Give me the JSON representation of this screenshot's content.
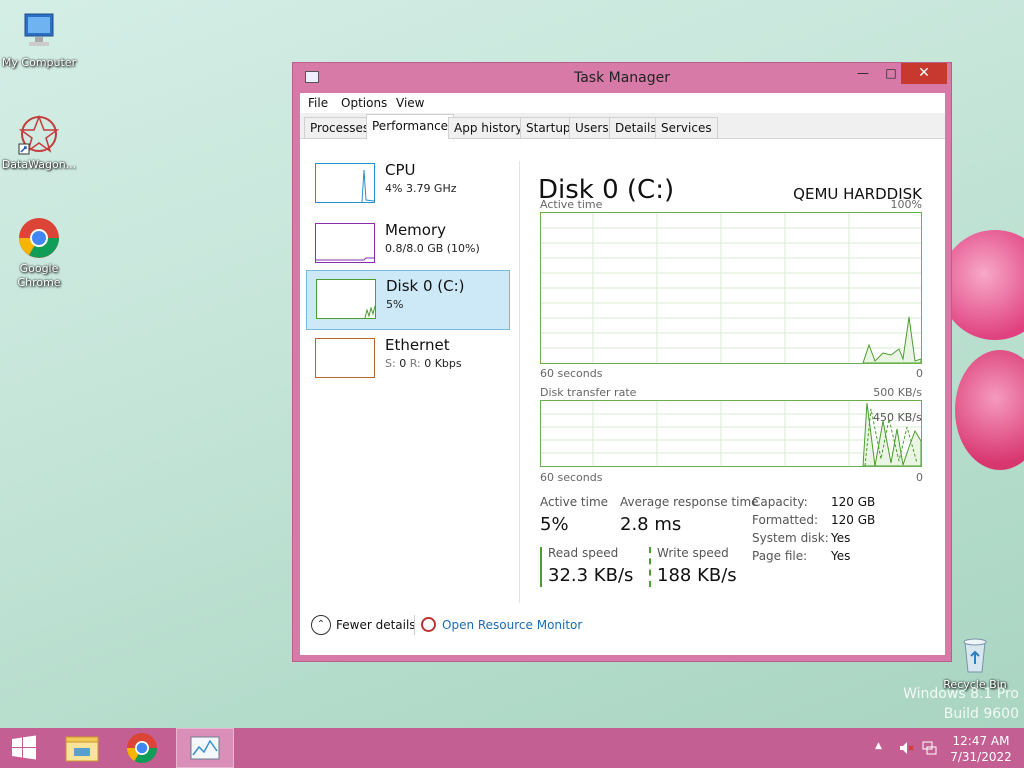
{
  "desktop": {
    "icons": [
      {
        "label": "My Computer"
      },
      {
        "label": "DataWagon..."
      },
      {
        "label": "Google Chrome"
      },
      {
        "label": "Recycle Bin"
      }
    ],
    "watermark": {
      "line1": "Windows 8.1 Pro",
      "line2": "Build 9600"
    }
  },
  "window": {
    "title": "Task Manager",
    "menu": [
      "File",
      "Options",
      "View"
    ],
    "tabs": [
      "Processes",
      "Performance",
      "App history",
      "Startup",
      "Users",
      "Details",
      "Services"
    ],
    "active_tab": "Performance",
    "resources": [
      {
        "title": "CPU",
        "sub": "4%  3.79 GHz",
        "color": "#2a8fd0"
      },
      {
        "title": "Memory",
        "sub": "0.8/8.0 GB (10%)",
        "color": "#8b2cae"
      },
      {
        "title": "Disk 0 (C:)",
        "sub": "5%",
        "color": "#4a9e2e"
      },
      {
        "title": "Ethernet",
        "sub_s": "S:",
        "sub_s_val": "0",
        "sub_r": "R:",
        "sub_r_val": "0 Kbps",
        "color": "#b8652a"
      }
    ],
    "detail": {
      "title": "Disk 0 (C:)",
      "model": "QEMU HARDDISK",
      "chart1": {
        "label": "Active time",
        "max_label": "100%",
        "x_left": "60 seconds",
        "x_right": "0"
      },
      "chart2": {
        "label": "Disk transfer rate",
        "max_label": "500 KB/s",
        "inner_label": "450 KB/s",
        "x_left": "60 seconds",
        "x_right": "0"
      },
      "stats": {
        "active_time_label": "Active time",
        "active_time_value": "5%",
        "avg_response_label": "Average response time",
        "avg_response_value": "2.8 ms",
        "read_label": "Read speed",
        "read_value": "32.3 KB/s",
        "write_label": "Write speed",
        "write_value": "188 KB/s"
      },
      "properties": [
        {
          "label": "Capacity:",
          "value": "120 GB"
        },
        {
          "label": "Formatted:",
          "value": "120 GB"
        },
        {
          "label": "System disk:",
          "value": "Yes"
        },
        {
          "label": "Page file:",
          "value": "Yes"
        }
      ]
    },
    "footer": {
      "fewer_details": "Fewer details",
      "open_monitor": "Open Resource Monitor"
    }
  },
  "taskbar": {
    "time": "12:47 AM",
    "date": "7/31/2022"
  },
  "colors": {
    "accent_window": "#d87aa8",
    "taskbar": "#c45f93",
    "disk_green": "#4a9e2e",
    "link_blue": "#1a6bb5"
  }
}
